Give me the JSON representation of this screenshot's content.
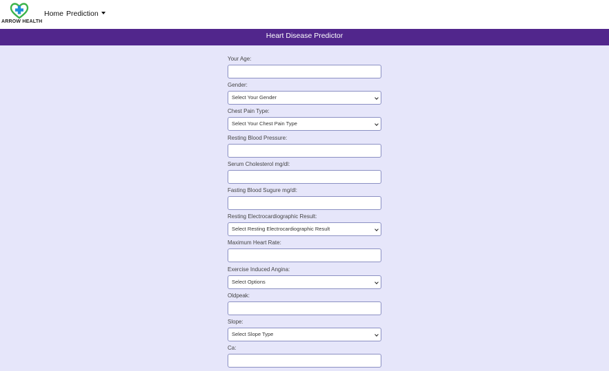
{
  "brand": {
    "name": "ARROW HEALTH"
  },
  "nav": {
    "home": "Home",
    "prediction": "Prediction"
  },
  "page": {
    "title": "Heart Disease Predictor"
  },
  "fields": [
    {
      "label": "Your Age:",
      "type": "input",
      "value": ""
    },
    {
      "label": "Gender:",
      "type": "select",
      "value": "Select Your Gender"
    },
    {
      "label": "Chest Pain Type:",
      "type": "select",
      "value": "Select Your Chest Pain Type"
    },
    {
      "label": "Resting Blood Pressure:",
      "type": "input",
      "value": ""
    },
    {
      "label": "Serum Cholesterol mg/dl:",
      "type": "input",
      "value": ""
    },
    {
      "label": "Fasting Blood Sugure mg/dl:",
      "type": "input",
      "value": ""
    },
    {
      "label": "Resting Electrocardiographic Result:",
      "type": "select",
      "value": "Select Resting Electrocardiographic Result"
    },
    {
      "label": "Maximum Heart Rate:",
      "type": "input",
      "value": ""
    },
    {
      "label": "Exercise Induced Angina:",
      "type": "select",
      "value": "Select Options"
    },
    {
      "label": "Oldpeak:",
      "type": "input",
      "value": ""
    },
    {
      "label": "Slope:",
      "type": "select",
      "value": "Select Slope Type"
    },
    {
      "label": "Ca:",
      "type": "input",
      "value": ""
    }
  ],
  "colors": {
    "header_bar": "#51268c",
    "page_background": "#e6e6fa",
    "logo_green": "#3cb44a",
    "logo_blue": "#1f8fd6"
  },
  "icons": {
    "logo": "heart-cross-icon",
    "dropdown": "chevron-down-icon",
    "nav_caret": "caret-down-icon"
  }
}
